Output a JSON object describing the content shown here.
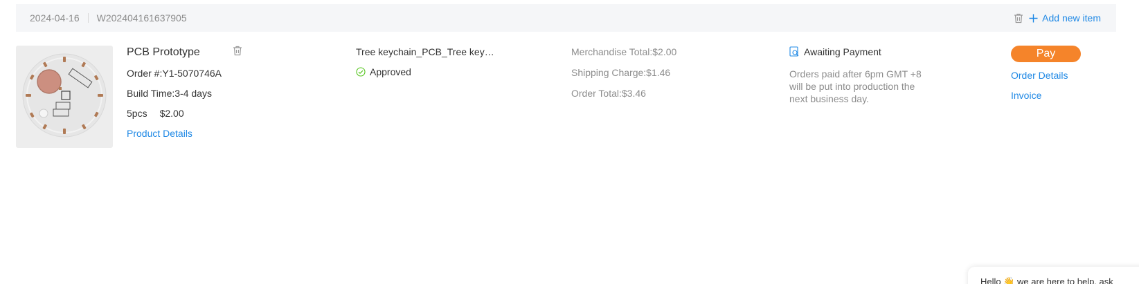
{
  "order": {
    "date": "2024-04-16",
    "number": "W202404161637905",
    "add_item_label": "Add new item"
  },
  "product": {
    "title": "PCB Prototype",
    "order_no": "Order #:Y1-5070746A",
    "build_time": "Build Time:3-4 days",
    "quantity": "5pcs",
    "price": "$2.00",
    "details_link": "Product Details"
  },
  "file": {
    "name": "Tree keychain_PCB_Tree keychain",
    "status": "Approved"
  },
  "totals": {
    "merchandise": "Merchandise Total:$2.00",
    "shipping": "Shipping Charge:$1.46",
    "order_total": "Order Total:$3.46"
  },
  "payment": {
    "status": "Awaiting Payment",
    "note": "Orders paid after 6pm GMT +8 will be put into production the next business day."
  },
  "actions": {
    "pay": "Pay",
    "order_details": "Order Details",
    "invoice": "Invoice"
  },
  "chat": {
    "greeting": "Hello 👋 we are here to help, ask"
  },
  "colors": {
    "accent": "#1e88e5",
    "pay_button": "#f5842a",
    "approved": "#52c41a",
    "header_bg": "#f5f6f8"
  },
  "icons": {
    "trash": "trash-icon",
    "add": "plus-icon",
    "approved": "check-circle-icon",
    "awaiting": "search-document-icon"
  }
}
